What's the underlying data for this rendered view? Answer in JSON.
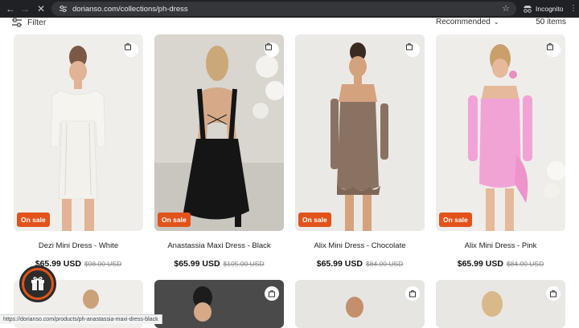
{
  "browser": {
    "url": "dorianso.com/collections/ph-dress",
    "incognito_label": "Incognito",
    "status_url": "https://dorianso.com/products/ph-anastassia-maxi-dress-black"
  },
  "toolbar": {
    "filter_label": "Filter",
    "sort_label": "Recommended",
    "items_count": "50 items"
  },
  "colors": {
    "sale_badge": "#e2531b",
    "gift_button": "#e2531b",
    "chrome_bg": "#202124"
  },
  "products": [
    {
      "name": "Dezi Mini Dress - White",
      "price": "$65.99 USD",
      "compare_price": "$98.00 USD",
      "badge": "On sale",
      "dress_color": "#f3f1ec"
    },
    {
      "name": "Anastassia Maxi Dress - Black",
      "price": "$65.99 USD",
      "compare_price": "$105.00 USD",
      "badge": "On sale",
      "dress_color": "#141414"
    },
    {
      "name": "Alix Mini Dress - Chocolate",
      "price": "$65.99 USD",
      "compare_price": "$84.00 USD",
      "badge": "On sale",
      "dress_color": "#8a7262"
    },
    {
      "name": "Alix Mini Dress - Pink",
      "price": "$65.99 USD",
      "compare_price": "$84.00 USD",
      "badge": "On sale",
      "dress_color": "#f2a3d6"
    }
  ],
  "icons": {
    "back": "arrow-left-icon",
    "forward": "arrow-right-icon",
    "reload": "close-icon",
    "filter": "sliders-icon",
    "bag": "shopping-bag-icon",
    "gift": "gift-icon",
    "star": "star-icon"
  }
}
